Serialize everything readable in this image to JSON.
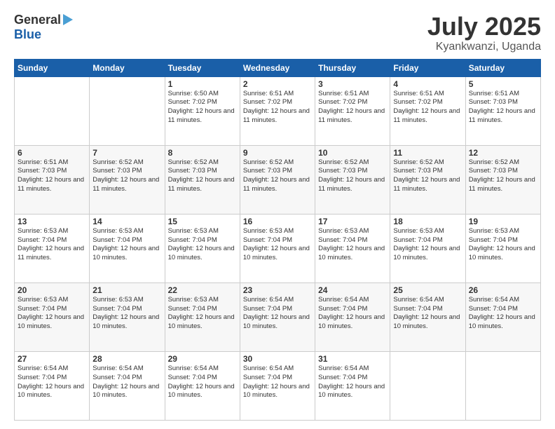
{
  "header": {
    "logo_general": "General",
    "logo_blue": "Blue",
    "month_title": "July 2025",
    "location": "Kyankwanzi, Uganda"
  },
  "weekdays": [
    "Sunday",
    "Monday",
    "Tuesday",
    "Wednesday",
    "Thursday",
    "Friday",
    "Saturday"
  ],
  "weeks": [
    [
      {
        "day": null
      },
      {
        "day": null
      },
      {
        "day": "1",
        "sunrise": "6:50 AM",
        "sunset": "7:02 PM",
        "daylight": "12 hours and 11 minutes."
      },
      {
        "day": "2",
        "sunrise": "6:51 AM",
        "sunset": "7:02 PM",
        "daylight": "12 hours and 11 minutes."
      },
      {
        "day": "3",
        "sunrise": "6:51 AM",
        "sunset": "7:02 PM",
        "daylight": "12 hours and 11 minutes."
      },
      {
        "day": "4",
        "sunrise": "6:51 AM",
        "sunset": "7:02 PM",
        "daylight": "12 hours and 11 minutes."
      },
      {
        "day": "5",
        "sunrise": "6:51 AM",
        "sunset": "7:03 PM",
        "daylight": "12 hours and 11 minutes."
      }
    ],
    [
      {
        "day": "6",
        "sunrise": "6:51 AM",
        "sunset": "7:03 PM",
        "daylight": "12 hours and 11 minutes."
      },
      {
        "day": "7",
        "sunrise": "6:52 AM",
        "sunset": "7:03 PM",
        "daylight": "12 hours and 11 minutes."
      },
      {
        "day": "8",
        "sunrise": "6:52 AM",
        "sunset": "7:03 PM",
        "daylight": "12 hours and 11 minutes."
      },
      {
        "day": "9",
        "sunrise": "6:52 AM",
        "sunset": "7:03 PM",
        "daylight": "12 hours and 11 minutes."
      },
      {
        "day": "10",
        "sunrise": "6:52 AM",
        "sunset": "7:03 PM",
        "daylight": "12 hours and 11 minutes."
      },
      {
        "day": "11",
        "sunrise": "6:52 AM",
        "sunset": "7:03 PM",
        "daylight": "12 hours and 11 minutes."
      },
      {
        "day": "12",
        "sunrise": "6:52 AM",
        "sunset": "7:03 PM",
        "daylight": "12 hours and 11 minutes."
      }
    ],
    [
      {
        "day": "13",
        "sunrise": "6:53 AM",
        "sunset": "7:04 PM",
        "daylight": "12 hours and 11 minutes."
      },
      {
        "day": "14",
        "sunrise": "6:53 AM",
        "sunset": "7:04 PM",
        "daylight": "12 hours and 10 minutes."
      },
      {
        "day": "15",
        "sunrise": "6:53 AM",
        "sunset": "7:04 PM",
        "daylight": "12 hours and 10 minutes."
      },
      {
        "day": "16",
        "sunrise": "6:53 AM",
        "sunset": "7:04 PM",
        "daylight": "12 hours and 10 minutes."
      },
      {
        "day": "17",
        "sunrise": "6:53 AM",
        "sunset": "7:04 PM",
        "daylight": "12 hours and 10 minutes."
      },
      {
        "day": "18",
        "sunrise": "6:53 AM",
        "sunset": "7:04 PM",
        "daylight": "12 hours and 10 minutes."
      },
      {
        "day": "19",
        "sunrise": "6:53 AM",
        "sunset": "7:04 PM",
        "daylight": "12 hours and 10 minutes."
      }
    ],
    [
      {
        "day": "20",
        "sunrise": "6:53 AM",
        "sunset": "7:04 PM",
        "daylight": "12 hours and 10 minutes."
      },
      {
        "day": "21",
        "sunrise": "6:53 AM",
        "sunset": "7:04 PM",
        "daylight": "12 hours and 10 minutes."
      },
      {
        "day": "22",
        "sunrise": "6:53 AM",
        "sunset": "7:04 PM",
        "daylight": "12 hours and 10 minutes."
      },
      {
        "day": "23",
        "sunrise": "6:54 AM",
        "sunset": "7:04 PM",
        "daylight": "12 hours and 10 minutes."
      },
      {
        "day": "24",
        "sunrise": "6:54 AM",
        "sunset": "7:04 PM",
        "daylight": "12 hours and 10 minutes."
      },
      {
        "day": "25",
        "sunrise": "6:54 AM",
        "sunset": "7:04 PM",
        "daylight": "12 hours and 10 minutes."
      },
      {
        "day": "26",
        "sunrise": "6:54 AM",
        "sunset": "7:04 PM",
        "daylight": "12 hours and 10 minutes."
      }
    ],
    [
      {
        "day": "27",
        "sunrise": "6:54 AM",
        "sunset": "7:04 PM",
        "daylight": "12 hours and 10 minutes."
      },
      {
        "day": "28",
        "sunrise": "6:54 AM",
        "sunset": "7:04 PM",
        "daylight": "12 hours and 10 minutes."
      },
      {
        "day": "29",
        "sunrise": "6:54 AM",
        "sunset": "7:04 PM",
        "daylight": "12 hours and 10 minutes."
      },
      {
        "day": "30",
        "sunrise": "6:54 AM",
        "sunset": "7:04 PM",
        "daylight": "12 hours and 10 minutes."
      },
      {
        "day": "31",
        "sunrise": "6:54 AM",
        "sunset": "7:04 PM",
        "daylight": "12 hours and 10 minutes."
      },
      {
        "day": null
      },
      {
        "day": null
      }
    ]
  ]
}
